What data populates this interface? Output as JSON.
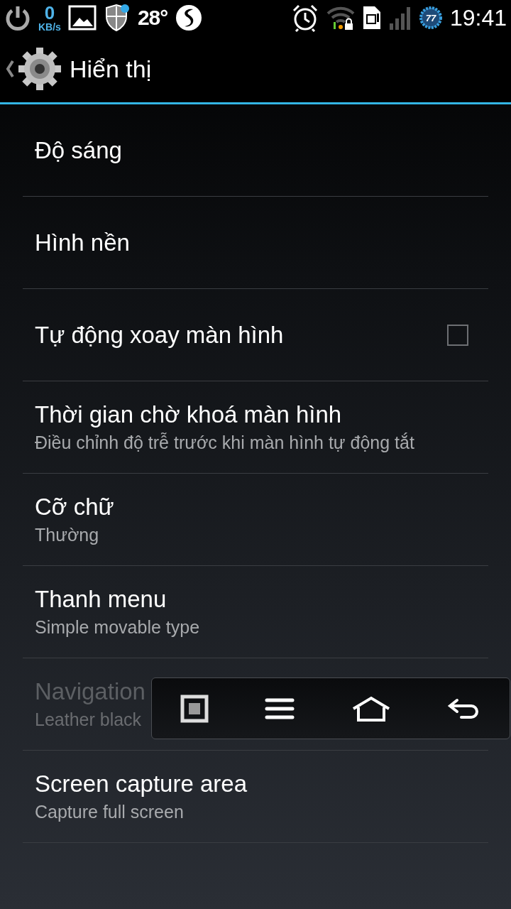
{
  "status_bar": {
    "speed_value": "0",
    "speed_unit": "KB/s",
    "temperature": "28°",
    "battery": "77",
    "time": "19:41"
  },
  "action_bar": {
    "title": "Hiển thị"
  },
  "items": [
    {
      "kind": "plain",
      "title": "Độ sáng",
      "disabled": false
    },
    {
      "kind": "plain",
      "title": "Hình nền",
      "disabled": false
    },
    {
      "kind": "checkbox",
      "title": "Tự động xoay màn hình",
      "checked": false,
      "disabled": false
    },
    {
      "kind": "plain",
      "title": "Thời gian chờ khoá màn hình",
      "summary": "Điều chỉnh độ trễ trước khi màn hình tự động tắt",
      "disabled": false
    },
    {
      "kind": "plain",
      "title": "Cỡ chữ",
      "summary": "Thường",
      "disabled": false
    },
    {
      "kind": "plain",
      "title": "Thanh menu",
      "summary": "Simple movable type",
      "disabled": false
    },
    {
      "kind": "plain",
      "title": "Navigation",
      "summary": "Leather black",
      "disabled": true
    },
    {
      "kind": "plain",
      "title": "Screen capture area",
      "summary": "Capture full screen",
      "disabled": false
    }
  ]
}
